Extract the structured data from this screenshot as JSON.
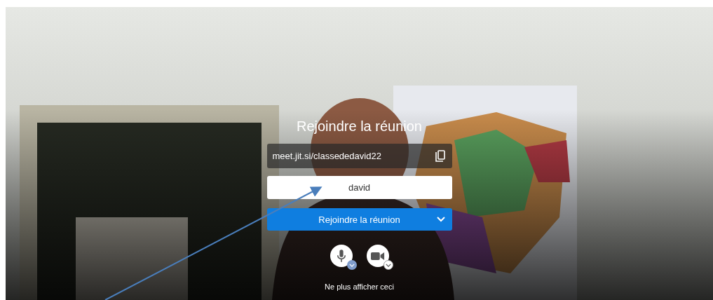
{
  "prejoin": {
    "title": "Rejoindre la réunion",
    "room_url": "meet.jit.si/classededavid22",
    "name_field": {
      "value": "david"
    },
    "join_button": {
      "label": "Rejoindre la réunion"
    },
    "dont_show_again": "Ne plus afficher ceci"
  }
}
